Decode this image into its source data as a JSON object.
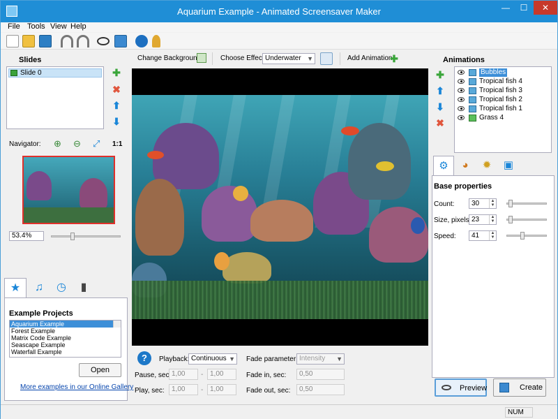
{
  "window": {
    "title": "Aquarium Example - Animated Screensaver Maker",
    "min_glyph": "—",
    "max_glyph": "☐",
    "close_glyph": "✕"
  },
  "menu": [
    "File",
    "Tools",
    "View",
    "Help"
  ],
  "toolbar": {
    "icons": [
      "new-icon",
      "open-icon",
      "save-icon",
      "undo-icon",
      "redo-icon",
      "preview-icon",
      "publish-icon",
      "info-icon",
      "key-icon"
    ]
  },
  "slides": {
    "title": "Slides",
    "items": [
      "Slide 0"
    ],
    "add_glyph": "✚",
    "delete_glyph": "✖",
    "up_glyph": "⬆",
    "down_glyph": "⬇"
  },
  "navigator": {
    "label": "Navigator:",
    "zoom_in": "⊕",
    "zoom_out": "⊖",
    "fit": "⤢",
    "one_to_one": "1:1",
    "zoom_value": "53.4%",
    "zoom_slider_fraction": 0.3
  },
  "bottom_tabs": [
    {
      "name": "star",
      "glyph": "★"
    },
    {
      "name": "music",
      "glyph": "♫"
    },
    {
      "name": "clock",
      "glyph": "◷"
    },
    {
      "name": "video",
      "glyph": "▮"
    }
  ],
  "examples": {
    "title": "Example Projects",
    "items": [
      "Aquarium Example",
      "Forest Example",
      "Matrix Code Example",
      "Seascape Example",
      "Waterfall Example"
    ],
    "selected_index": 0,
    "open_label": "Open",
    "gallery_link": "More examples in our Online Gallery"
  },
  "top_controls": {
    "change_background": "Change Background",
    "choose_effect_label": "Choose Effect:",
    "effect_value": "Underwater",
    "add_animation": "Add Animation",
    "add_glyph": "✚"
  },
  "animations": {
    "title": "Animations",
    "items": [
      "Bubbles",
      "Tropical fish 4",
      "Tropical fish 3",
      "Tropical fish 2",
      "Tropical fish 1",
      "Grass 4"
    ],
    "selected_index": 0,
    "add_glyph": "✚",
    "up_glyph": "⬆",
    "down_glyph": "⬇",
    "delete_glyph": "✖"
  },
  "right_tabs": [
    {
      "name": "gear",
      "glyph": "⚙"
    },
    {
      "name": "palette",
      "glyph": "◕"
    },
    {
      "name": "compass",
      "glyph": "✹"
    },
    {
      "name": "crop",
      "glyph": "▣"
    }
  ],
  "base_properties": {
    "title": "Base properties",
    "count_label": "Count:",
    "count_value": "30",
    "count_fraction": 0.05,
    "size_label": "Size, pixels:",
    "size_value": "23",
    "size_fraction": 0.05,
    "speed_label": "Speed:",
    "speed_value": "41",
    "speed_fraction": 0.38
  },
  "playback": {
    "playback_label": "Playback:",
    "playback_value": "Continuous",
    "pause_label": "Pause, sec:",
    "pause_from": "1,00",
    "pause_to": "1,00",
    "play_label": "Play, sec:",
    "play_from": "1,00",
    "play_to": "1,00",
    "dash": "-",
    "fade_param_label": "Fade parameter:",
    "fade_param_value": "Intensity",
    "fade_in_label": "Fade in, sec:",
    "fade_in_value": "0,50",
    "fade_out_label": "Fade out, sec:",
    "fade_out_value": "0,50",
    "help_glyph": "?"
  },
  "actions": {
    "preview_label": "Preview",
    "create_label": "Create"
  },
  "status": {
    "num": "NUM"
  },
  "colors": {
    "titlebar": "#1f8ed6",
    "selection": "#3d8fd8",
    "close": "#c7392b"
  }
}
